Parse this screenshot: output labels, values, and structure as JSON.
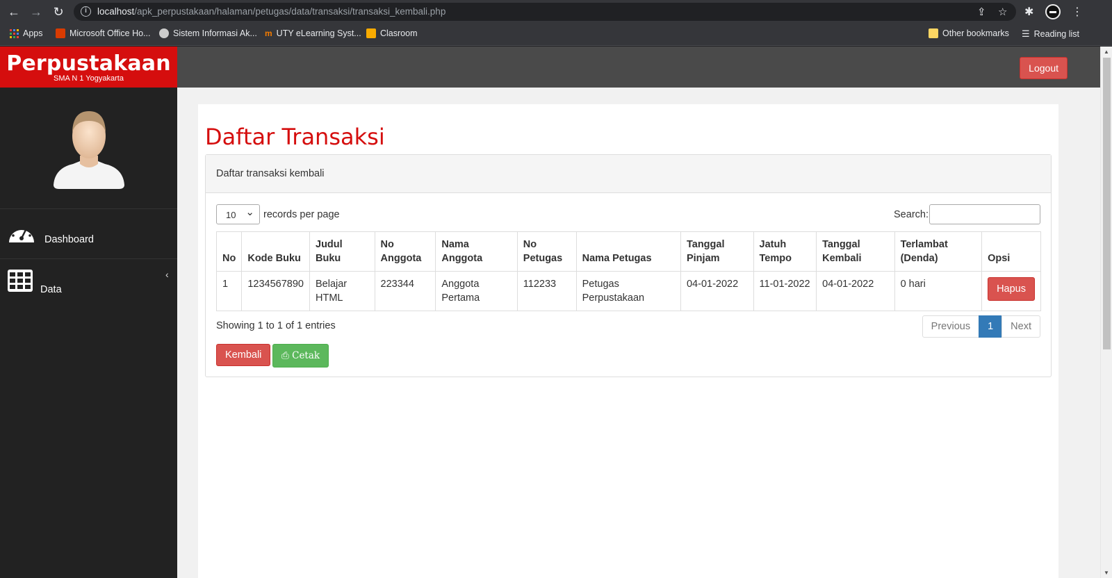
{
  "browser": {
    "url_host": "localhost",
    "url_path": "/apk_perpustakaan/halaman/petugas/data/transaksi/transaksi_kembali.php",
    "bookmarks": [
      "Apps",
      "Microsoft Office Ho...",
      "Sistem Informasi Ak...",
      "UTY eLearning Syst...",
      "Clasroom"
    ],
    "other_bookmarks": "Other bookmarks",
    "reading_list": "Reading list"
  },
  "brand": {
    "name": "Perpustakaan",
    "subtitle": "SMA N 1 Yogyakarta"
  },
  "topbar": {
    "logout_label": "Logout"
  },
  "sidebar": {
    "items": [
      {
        "label": "Dashboard",
        "icon": "dashboard-gauge-icon"
      },
      {
        "label": "Data",
        "icon": "table-grid-icon"
      }
    ]
  },
  "page": {
    "title": "Daftar Transaksi",
    "panel_heading": "Daftar transaksi kembali",
    "length_value": "10",
    "length_label": "records per page",
    "search_label": "Search:",
    "table": {
      "headers": [
        "No",
        "Kode Buku",
        "Judul Buku",
        "No Anggota",
        "Nama Anggota",
        "No Petugas",
        "Nama Petugas",
        "Tanggal Pinjam",
        "Jatuh Tempo",
        "Tanggal Kembali",
        "Terlambat (Denda)",
        "Opsi"
      ],
      "rows": [
        [
          "1",
          "1234567890",
          "Belajar HTML",
          "223344",
          "Anggota Pertama",
          "112233",
          "Petugas Perpustakaan",
          "04-01-2022",
          "11-01-2022",
          "04-01-2022",
          "0 hari"
        ]
      ],
      "row_action": "Hapus"
    },
    "info": "Showing 1 to 1 of 1 entries",
    "pagination": {
      "previous": "Previous",
      "current": "1",
      "next": "Next"
    },
    "kembali_label": "Kembali",
    "cetak_label": "Cetak"
  },
  "colors": {
    "brand_red": "#d50e0e",
    "danger": "#d9534f",
    "success": "#5cb85c",
    "primary": "#337ab7"
  }
}
